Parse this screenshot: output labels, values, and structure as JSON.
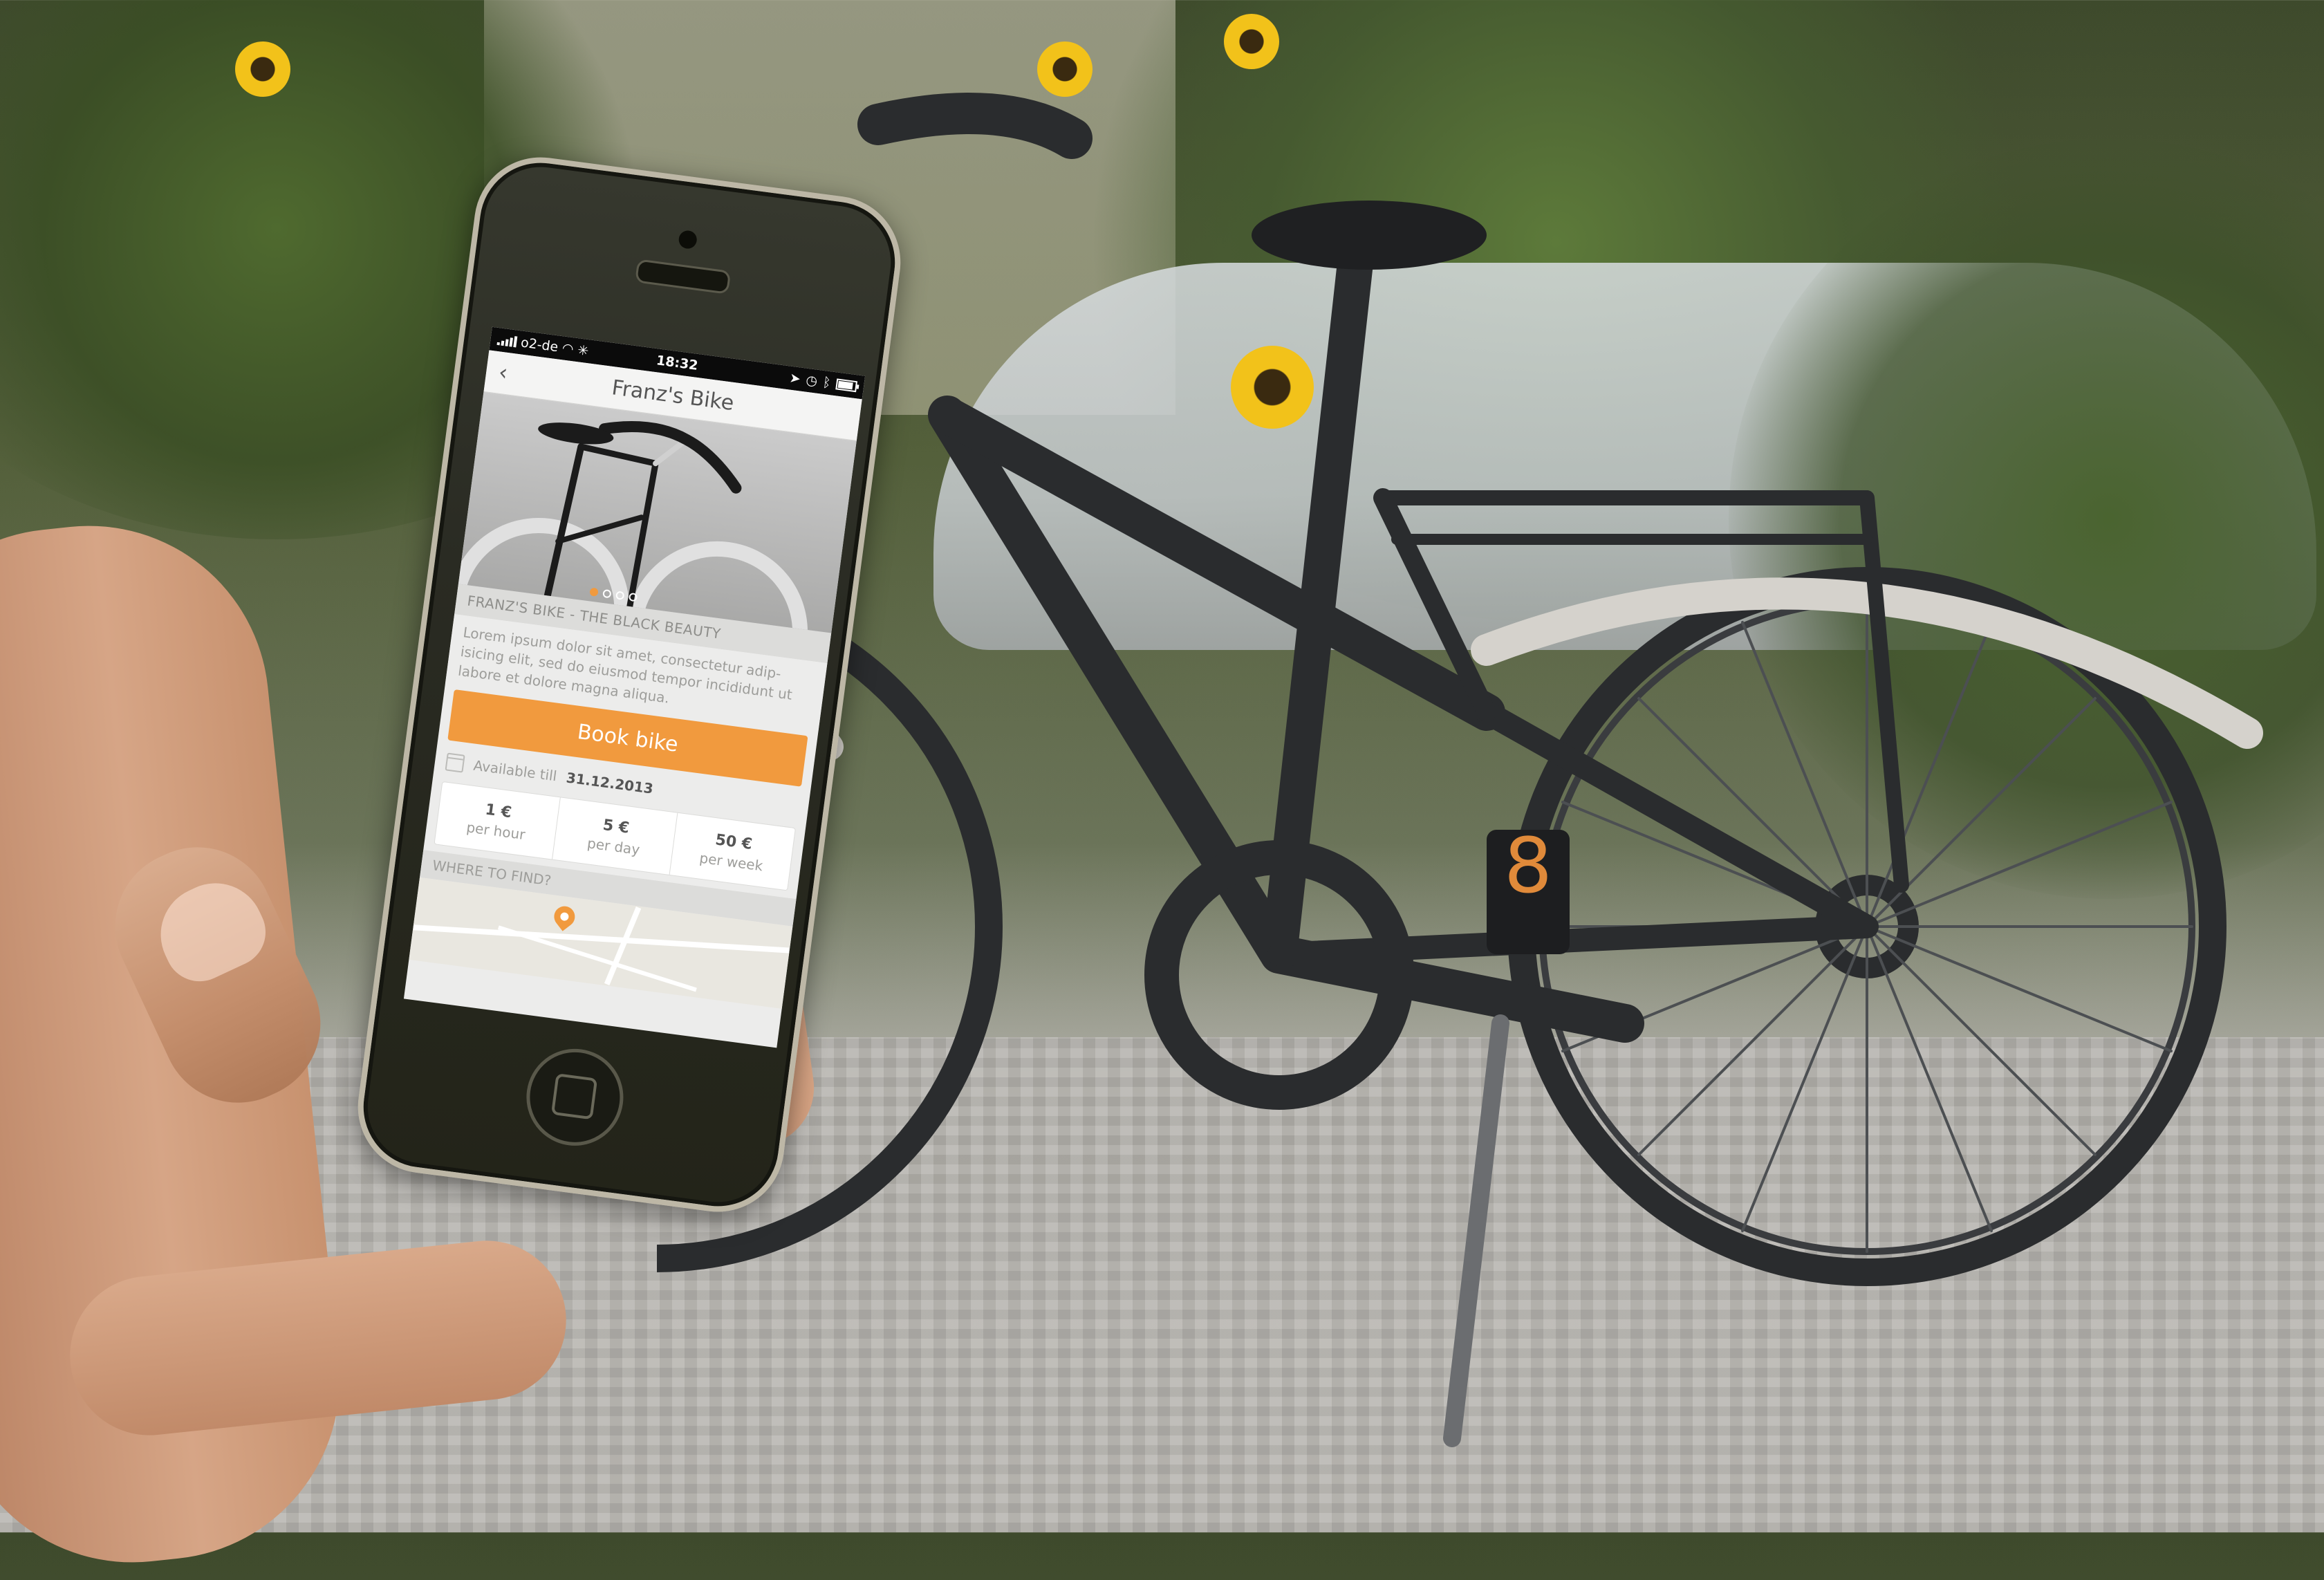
{
  "status_bar": {
    "carrier": "o2-de",
    "time": "18:32"
  },
  "nav": {
    "back_icon": "chevron-left-icon",
    "title": "Franz's Bike"
  },
  "gallery": {
    "dot_count": 4,
    "active_index": 0
  },
  "bike": {
    "subheader": "FRANZ'S BIKE - THE BLACK BEAUTY",
    "description": "Lorem ipsum dolor sit amet, consectetur adip-isicing elit, sed do eiusmod tempor incididunt ut labore et dolore magna aliqua."
  },
  "actions": {
    "book_label": "Book bike"
  },
  "availability": {
    "label": "Available till",
    "date": "31.12.2013"
  },
  "prices": [
    {
      "amount": "1 €",
      "unit": "per hour"
    },
    {
      "amount": "5 €",
      "unit": "per day"
    },
    {
      "amount": "50 €",
      "unit": "per week"
    }
  ],
  "location": {
    "header": "WHERE TO FIND?"
  },
  "colors": {
    "accent": "#f19a3e",
    "text_dark": "#555555",
    "text_muted": "#9d9d9a"
  }
}
